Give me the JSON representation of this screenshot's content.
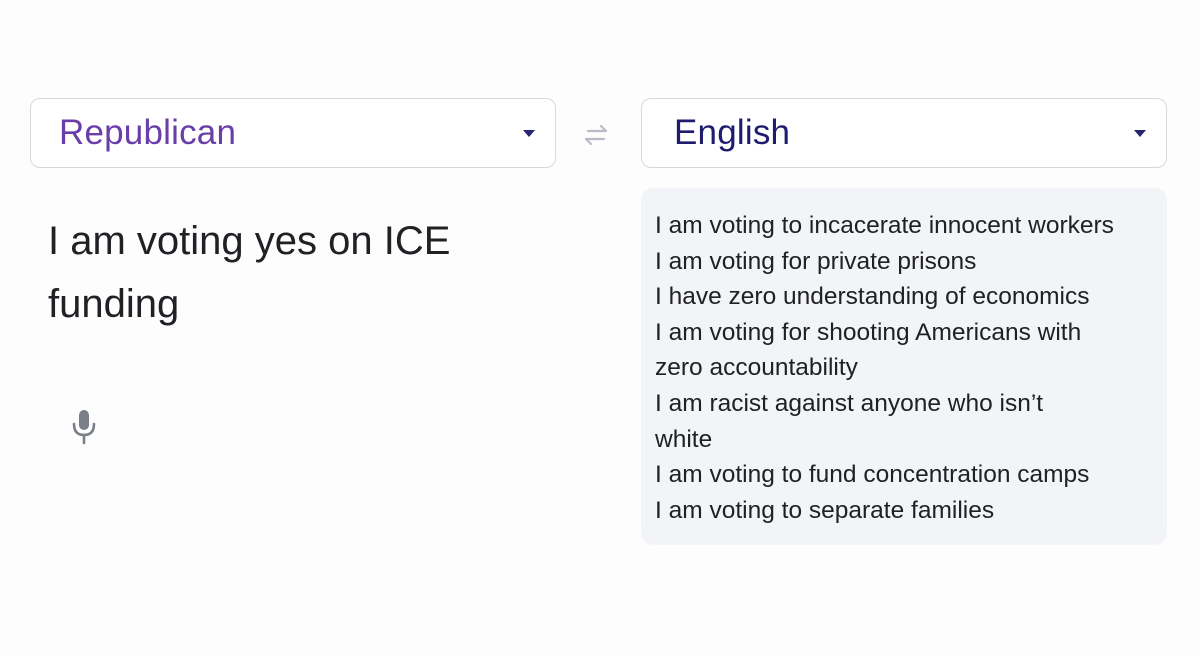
{
  "source_language": {
    "label": "Republican",
    "color": "#6a3ea8"
  },
  "target_language": {
    "label": "English",
    "color": "#1f1b6e"
  },
  "icons": {
    "swap": "swap-arrows-icon",
    "dropdown": "chevron-down-icon",
    "microphone": "microphone-icon"
  },
  "source_text": {
    "line1": "I am voting yes on ICE",
    "line2": "funding"
  },
  "translation": {
    "lines": [
      "I am voting to incacerate innocent workers",
      "I am voting for private prisons",
      "I have zero understanding of economics",
      "I am voting for shooting Americans with",
      "zero accountability",
      "I am racist against anyone who isn’t",
      "white",
      "I am voting to fund concentration camps",
      "I am voting to separate families"
    ]
  }
}
